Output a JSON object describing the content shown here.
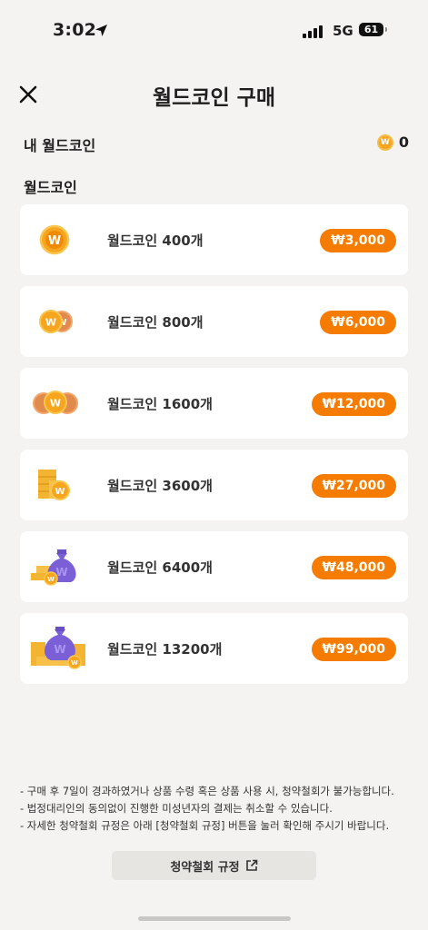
{
  "status_bar": {
    "time": "3:02",
    "network": "5G",
    "battery": "61"
  },
  "header": {
    "title": "월드코인 구매",
    "close_icon": "close-icon"
  },
  "my_coin": {
    "label": "내 월드코인",
    "value": "0",
    "coin_mark": "W"
  },
  "section": {
    "title": "월드코인"
  },
  "products": [
    {
      "name": "월드코인 400개",
      "price": "₩3,000",
      "icon": "single-coin-icon"
    },
    {
      "name": "월드코인 800개",
      "price": "₩6,000",
      "icon": "two-coins-icon"
    },
    {
      "name": "월드코인 1600개",
      "price": "₩12,000",
      "icon": "three-coins-icon"
    },
    {
      "name": "월드코인 3600개",
      "price": "₩27,000",
      "icon": "coin-stack-icon"
    },
    {
      "name": "월드코인 6400개",
      "price": "₩48,000",
      "icon": "coin-bag-icon"
    },
    {
      "name": "월드코인 13200개",
      "price": "₩99,000",
      "icon": "coin-bag-pile-icon"
    }
  ],
  "coin_mark": "W",
  "notes": [
    "- 구매 후 7일이 경과하였거나 상품 수령 혹은 상품 사용 시, 청약철회가 불가능합니다.",
    "- 법정대리인의 동의없이 진행한 미성년자의 결제는 취소할 수 있습니다.",
    "- 자세한 청약철회 규정은 아래 [청약철회 규정] 버튼을 눌러 확인해 주시기 바랍니다."
  ],
  "policy_button": {
    "label": "청약철회 규정",
    "icon": "external-link-icon"
  },
  "colors": {
    "accent": "#f57c00",
    "coin": "#f7a51e",
    "bag": "#7b5fd6",
    "background": "#f4f3f1"
  }
}
